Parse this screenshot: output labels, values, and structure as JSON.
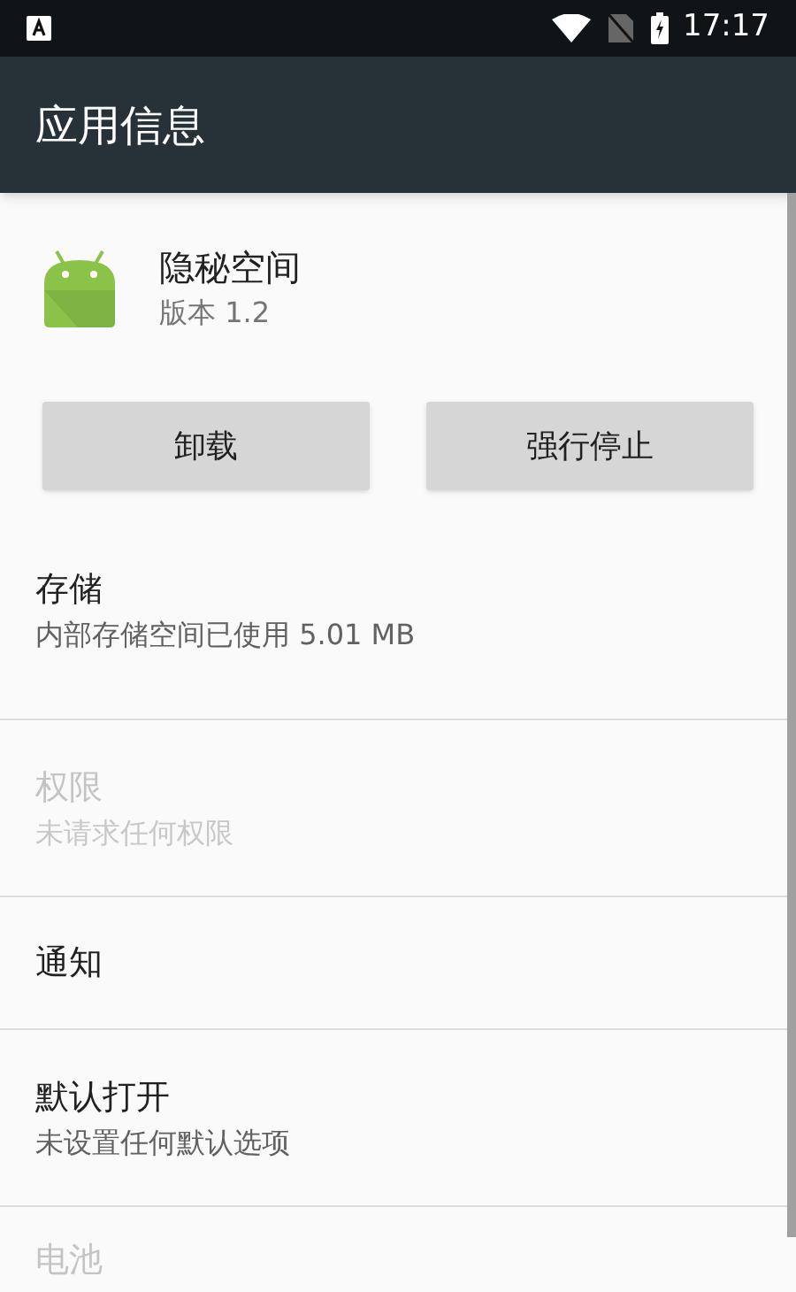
{
  "status_bar": {
    "time": "17:17"
  },
  "app_bar": {
    "title": "应用信息"
  },
  "app": {
    "name": "隐秘空间",
    "version": "版本 1.2"
  },
  "buttons": [
    {
      "label": "卸载"
    },
    {
      "label": "强行停止"
    }
  ],
  "settings": [
    {
      "title": "存储",
      "summary": "内部存储空间已使用 5.01 MB",
      "disabled": false
    },
    {
      "title": "权限",
      "summary": "未请求任何权限",
      "disabled": true
    },
    {
      "title": "通知",
      "disabled": false
    },
    {
      "title": "默认打开",
      "summary": "未设置任何默认选项",
      "disabled": false
    },
    {
      "title": "电池",
      "disabled": true
    }
  ]
}
